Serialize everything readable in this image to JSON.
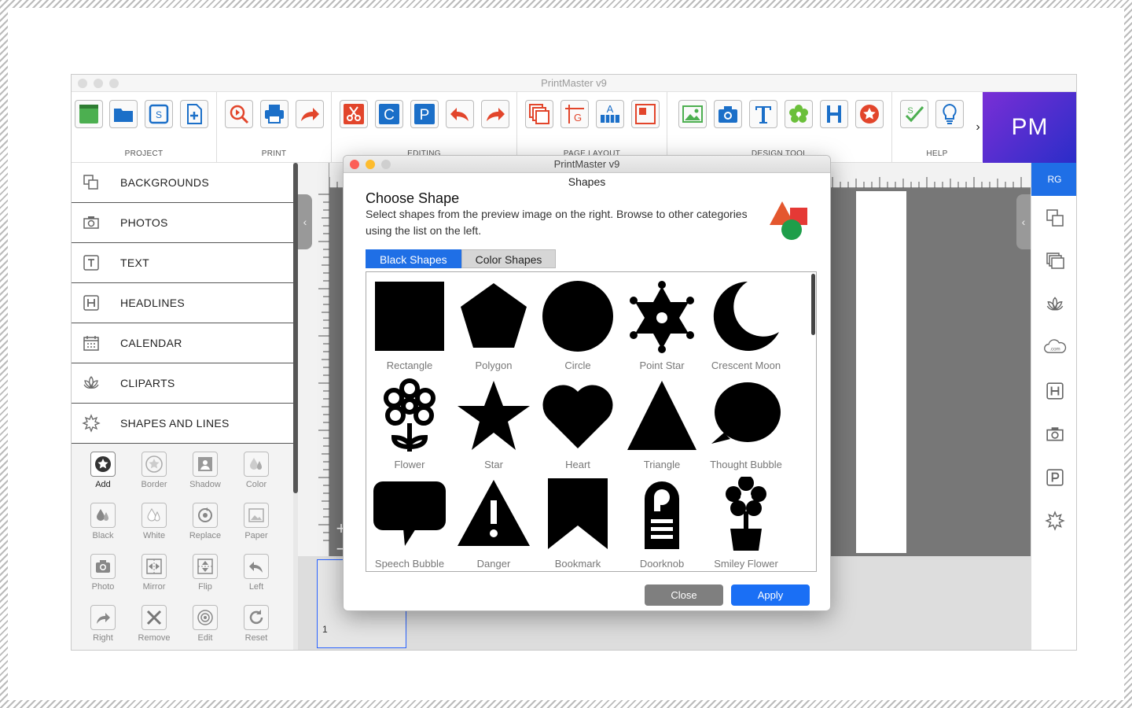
{
  "window": {
    "title": "PrintMaster v9"
  },
  "toolbar": {
    "groups": [
      {
        "label": "PROJECT"
      },
      {
        "label": "PRINT"
      },
      {
        "label": "EDITING"
      },
      {
        "label": "PAGE LAYOUT"
      },
      {
        "label": "DESIGN TOOL"
      },
      {
        "label": "HELP"
      }
    ],
    "logo": "PM"
  },
  "sidebar": {
    "items": [
      {
        "label": "BACKGROUNDS",
        "icon": "backgrounds-icon"
      },
      {
        "label": "PHOTOS",
        "icon": "camera-icon"
      },
      {
        "label": "TEXT",
        "icon": "text-icon"
      },
      {
        "label": "HEADLINES",
        "icon": "headline-icon"
      },
      {
        "label": "CALENDAR",
        "icon": "calendar-icon"
      },
      {
        "label": "CLIPARTS",
        "icon": "lotus-icon"
      },
      {
        "label": "SHAPES AND LINES",
        "icon": "star-burst-icon"
      }
    ]
  },
  "tools": {
    "items": [
      {
        "label": "Add"
      },
      {
        "label": "Border"
      },
      {
        "label": "Shadow"
      },
      {
        "label": "Color"
      },
      {
        "label": "Black"
      },
      {
        "label": "White"
      },
      {
        "label": "Replace"
      },
      {
        "label": "Paper"
      },
      {
        "label": "Photo"
      },
      {
        "label": "Mirror"
      },
      {
        "label": "Flip"
      },
      {
        "label": "Left"
      },
      {
        "label": "Right"
      },
      {
        "label": "Remove"
      },
      {
        "label": "Edit"
      },
      {
        "label": "Reset"
      }
    ]
  },
  "right_panel": {
    "avatar": "RG"
  },
  "canvas": {
    "page_number": "1",
    "zoom_in": "+",
    "zoom_out": "−"
  },
  "dialog": {
    "title": "PrintMaster v9",
    "subtitle": "Shapes",
    "heading": "Choose Shape",
    "description": "Select shapes from the preview image on the right. Browse to other categories using the list on the left.",
    "tabs": [
      {
        "label": "Black Shapes",
        "active": true
      },
      {
        "label": "Color Shapes",
        "active": false
      }
    ],
    "shapes": [
      {
        "label": "Rectangle"
      },
      {
        "label": "Polygon"
      },
      {
        "label": "Circle"
      },
      {
        "label": "Point Star"
      },
      {
        "label": "Crescent Moon"
      },
      {
        "label": "Flower"
      },
      {
        "label": "Star"
      },
      {
        "label": "Heart"
      },
      {
        "label": "Triangle"
      },
      {
        "label": "Thought Bubble"
      },
      {
        "label": "Speech Bubble"
      },
      {
        "label": "Danger"
      },
      {
        "label": "Bookmark"
      },
      {
        "label": "Doorknob"
      },
      {
        "label": "Smiley Flower"
      }
    ],
    "close_label": "Close",
    "apply_label": "Apply"
  },
  "colors": {
    "accent": "#1f6fe6",
    "icon_blue": "#1b6fc8",
    "icon_red": "#e2452b",
    "logo_start": "#7a2fd6",
    "logo_end": "#2a2dc8"
  }
}
